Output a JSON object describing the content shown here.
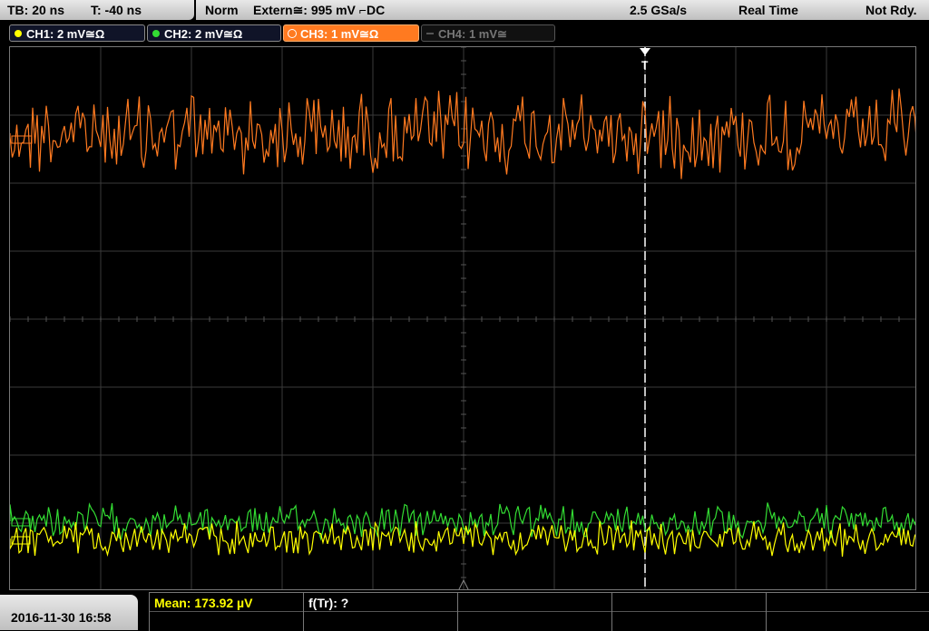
{
  "timebase": {
    "tb": "TB: 20 ns",
    "t": "T: -40 ns"
  },
  "status": {
    "mode": "Norm",
    "trigger": "Extern≅: 995 mV ⌐DC",
    "sample_rate": "2.5 GSa/s",
    "acq": "Real Time",
    "state": "Not Rdy."
  },
  "channels": [
    {
      "label": "CH1: 2 mV≅Ω",
      "color": "#ffff00",
      "active": true
    },
    {
      "label": "CH2: 2 mV≅Ω",
      "color": "#33dd33",
      "active": true
    },
    {
      "label": "CH3: 1 mV≅Ω",
      "color": "#ff7a20",
      "active": true
    },
    {
      "label": "CH4: 1 mV≅",
      "color": "#777777",
      "active": false
    }
  ],
  "trigger_marker": {
    "label": "T"
  },
  "datetime": "2016-11-30 16:58",
  "measurements": {
    "mean": "Mean: 173.92 µV",
    "ftr": "f(Tr): ?"
  },
  "colors": {
    "ch1": "#ffff00",
    "ch2": "#33dd33",
    "ch3": "#ff7a20",
    "grid": "#3a3a3a"
  }
}
